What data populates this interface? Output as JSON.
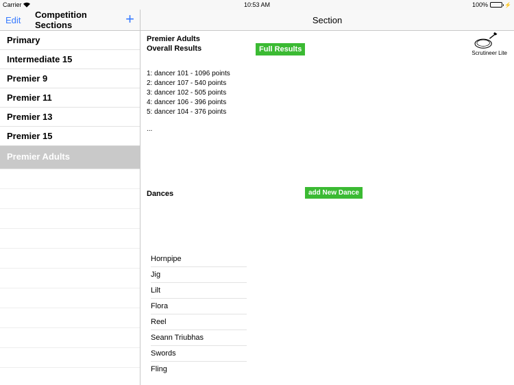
{
  "status": {
    "carrier": "Carrier",
    "time": "10:53 AM",
    "battery": "100%"
  },
  "sidebar": {
    "edit": "Edit",
    "title": "Competition Sections",
    "add": "+",
    "items": [
      {
        "label": "Primary"
      },
      {
        "label": "Intermediate 15"
      },
      {
        "label": "Premier 9"
      },
      {
        "label": "Premier 11"
      },
      {
        "label": "Premier 13"
      },
      {
        "label": "Premier 15"
      },
      {
        "label": "Premier Adults"
      }
    ]
  },
  "content": {
    "header": "Section",
    "subtitle": "Premier Adults",
    "overall": "Overall Results",
    "full_results": "Full Results",
    "brand": "Scrutineer Lite",
    "results": [
      "1: dancer 101 - 1096 points",
      "2: dancer 107 - 540 points",
      "3: dancer 102 - 505 points",
      "4: dancer 106 - 396 points",
      "5: dancer 104 - 376 points"
    ],
    "ellipsis": "...",
    "dances_header": "Dances",
    "add_dance": "add New Dance",
    "dances": [
      "Hornpipe",
      "Jig",
      "Lilt",
      "Flora",
      "Reel",
      "Seann Triubhas",
      "Swords",
      "Fling"
    ]
  }
}
